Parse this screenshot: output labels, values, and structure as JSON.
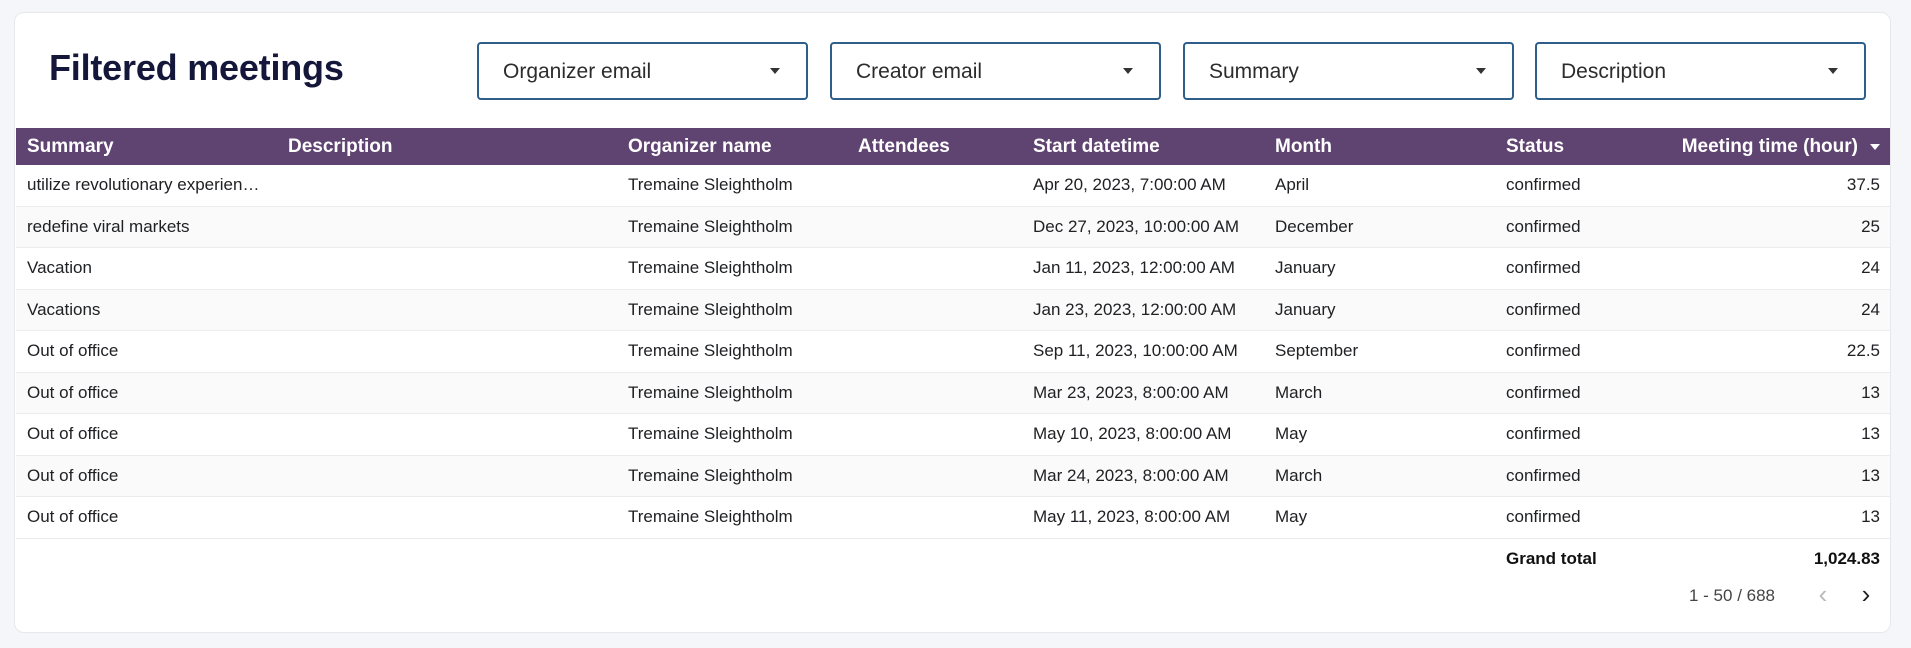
{
  "page": {
    "title": "Filtered meetings"
  },
  "filters": [
    {
      "label": "Organizer email"
    },
    {
      "label": "Creator email"
    },
    {
      "label": "Summary"
    },
    {
      "label": "Description"
    }
  ],
  "table": {
    "headers": {
      "summary": "Summary",
      "description": "Description",
      "organizer": "Organizer name",
      "attendees": "Attendees",
      "start": "Start datetime",
      "month": "Month",
      "status": "Status",
      "meeting_time": "Meeting time (hour)"
    },
    "sort": {
      "column": "meeting_time",
      "direction": "descending"
    },
    "rows": [
      {
        "summary": "utilize revolutionary experien…",
        "description": "",
        "organizer": "Tremaine Sleightholm",
        "attendees": "",
        "start": "Apr 20, 2023, 7:00:00 AM",
        "month": "April",
        "status": "confirmed",
        "meeting_time": "37.5"
      },
      {
        "summary": "redefine viral markets",
        "description": "",
        "organizer": "Tremaine Sleightholm",
        "attendees": "",
        "start": "Dec 27, 2023, 10:00:00 AM",
        "month": "December",
        "status": "confirmed",
        "meeting_time": "25"
      },
      {
        "summary": "Vacation",
        "description": "",
        "organizer": "Tremaine Sleightholm",
        "attendees": "",
        "start": "Jan 11, 2023, 12:00:00 AM",
        "month": "January",
        "status": "confirmed",
        "meeting_time": "24"
      },
      {
        "summary": "Vacations",
        "description": "",
        "organizer": "Tremaine Sleightholm",
        "attendees": "",
        "start": "Jan 23, 2023, 12:00:00 AM",
        "month": "January",
        "status": "confirmed",
        "meeting_time": "24"
      },
      {
        "summary": "Out of office",
        "description": "",
        "organizer": "Tremaine Sleightholm",
        "attendees": "",
        "start": "Sep 11, 2023, 10:00:00 AM",
        "month": "September",
        "status": "confirmed",
        "meeting_time": "22.5"
      },
      {
        "summary": "Out of office",
        "description": "",
        "organizer": "Tremaine Sleightholm",
        "attendees": "",
        "start": "Mar 23, 2023, 8:00:00 AM",
        "month": "March",
        "status": "confirmed",
        "meeting_time": "13"
      },
      {
        "summary": "Out of office",
        "description": "",
        "organizer": "Tremaine Sleightholm",
        "attendees": "",
        "start": "May 10, 2023, 8:00:00 AM",
        "month": "May",
        "status": "confirmed",
        "meeting_time": "13"
      },
      {
        "summary": "Out of office",
        "description": "",
        "organizer": "Tremaine Sleightholm",
        "attendees": "",
        "start": "Mar 24, 2023, 8:00:00 AM",
        "month": "March",
        "status": "confirmed",
        "meeting_time": "13"
      },
      {
        "summary": "Out of office",
        "description": "",
        "organizer": "Tremaine Sleightholm",
        "attendees": "",
        "start": "May 11, 2023, 8:00:00 AM",
        "month": "May",
        "status": "confirmed",
        "meeting_time": "13"
      }
    ],
    "grand_total": {
      "label": "Grand total",
      "value": "1,024.83"
    }
  },
  "pagination": {
    "range": "1 - 50 / 688",
    "prev_icon": "chevron-left-icon",
    "next_icon": "chevron-right-icon"
  },
  "colors": {
    "header_bg": "#5f4472",
    "filter_border": "#2e5e8a",
    "title": "#14163a"
  }
}
